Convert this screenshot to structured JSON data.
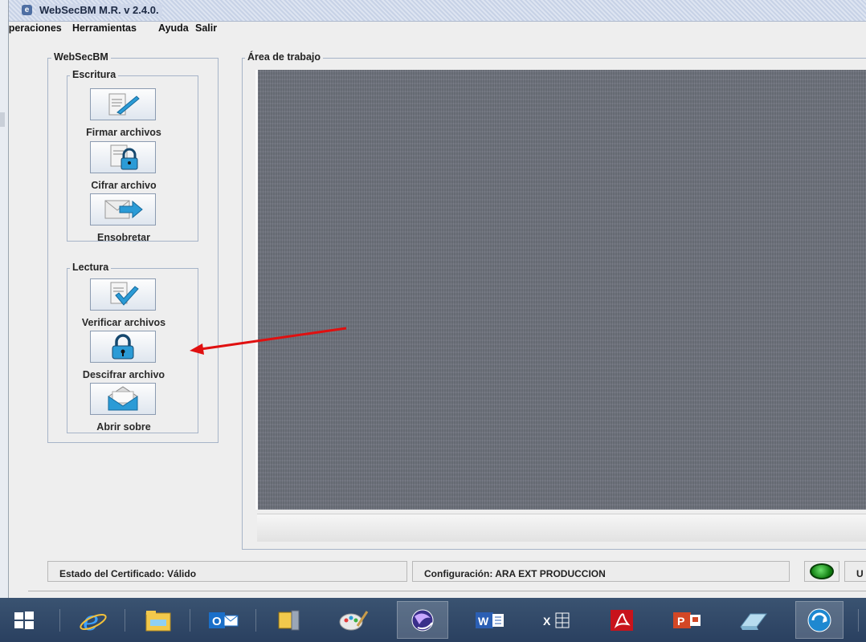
{
  "window": {
    "title": "WebSecBM M.R. v 2.4.0.",
    "app_icon_glyph": "e"
  },
  "menu": [
    "Operaciones",
    "Herramientas",
    "Ayuda",
    "Salir"
  ],
  "panel": {
    "title": "WebSecBM",
    "escritura": {
      "title": "Escritura",
      "buttons": [
        {
          "label": "Firmar archivos",
          "icon": "sign-document-icon"
        },
        {
          "label": "Cifrar archivo",
          "icon": "encrypt-lock-icon"
        },
        {
          "label": "Ensobretar",
          "icon": "envelope-arrow-icon"
        }
      ]
    },
    "lectura": {
      "title": "Lectura",
      "buttons": [
        {
          "label": "Verificar archivos",
          "icon": "verify-document-icon"
        },
        {
          "label": "Descifrar archivo",
          "icon": "decrypt-lock-icon"
        },
        {
          "label": "Abrir sobre",
          "icon": "open-envelope-icon"
        }
      ]
    }
  },
  "work_area": {
    "title": "Área de trabajo"
  },
  "status": {
    "certificate": "Estado del Certificado: Válido",
    "configuration": "Configuración: ARA EXT PRODUCCION",
    "led_color": "#1a9a1a",
    "truncated": "U"
  },
  "colors": {
    "annotation_arrow": "#e01010",
    "taskbar": "#2f4766",
    "work_area": "#6c717b"
  },
  "taskbar": {
    "icons": [
      "windows-start-icon",
      "internet-explorer-icon",
      "file-explorer-icon",
      "outlook-icon",
      "archive-icon",
      "paint-icon",
      "java-app-icon",
      "word-icon",
      "excel-icon",
      "acrobat-icon",
      "powerpoint-icon",
      "eraser-icon",
      "remote-icon"
    ],
    "word_text": "W",
    "excel_text": "X",
    "ppt_text": "P",
    "outlook_text": "O"
  }
}
